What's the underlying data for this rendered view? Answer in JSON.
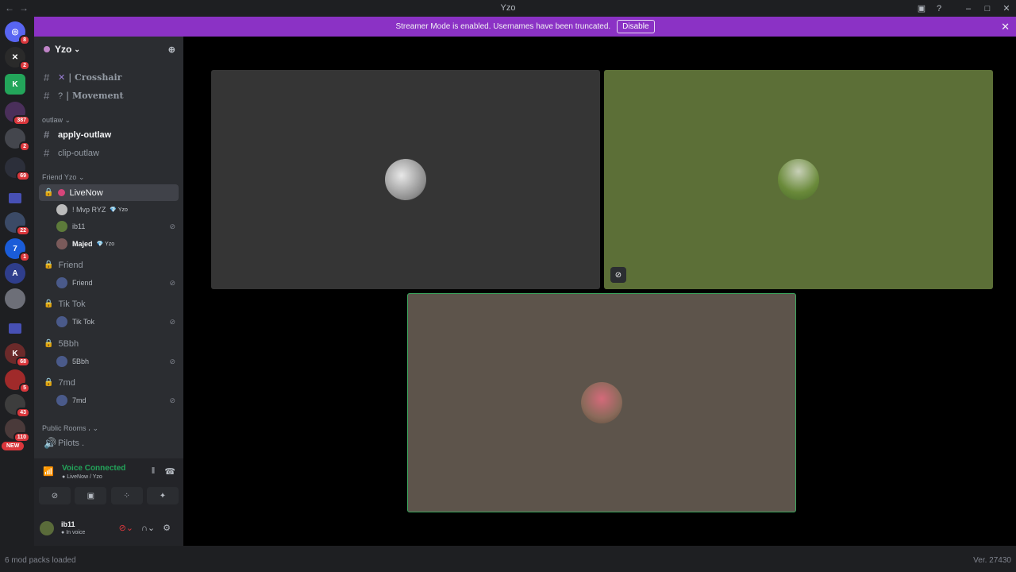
{
  "window": {
    "title": "Yzo",
    "back": "←",
    "forward": "→",
    "minimize": "–",
    "maximize": "□",
    "close": "✕"
  },
  "banner": {
    "text": "Streamer Mode is enabled. Usernames have been truncated.",
    "button": "Disable",
    "close": "✕"
  },
  "guilds": {
    "badges": [
      "8",
      "2",
      "387",
      "2",
      "69",
      "22",
      "1",
      "68",
      "5",
      "43",
      "110"
    ],
    "new_tag": "NEW"
  },
  "server": {
    "name": "Yzo"
  },
  "channels": [
    {
      "label": "| Crosshair"
    },
    {
      "label": "| Movement"
    }
  ],
  "categories": {
    "outlaw": "outlaw",
    "friend_yzo": "Friend Yzo",
    "public_rooms": "Public Rooms ،"
  },
  "outlaw_channels": [
    "apply-outlaw",
    "clip-outlaw"
  ],
  "voice_channels": [
    {
      "name": "LiveNow"
    },
    {
      "name": "Friend"
    },
    {
      "name": "Tik Tok"
    },
    {
      "name": "5Bbh"
    },
    {
      "name": "7md"
    }
  ],
  "livenow_users": [
    {
      "name": "! Mvp RYZ",
      "tag": "Yzo"
    },
    {
      "name": "ib11",
      "tag": ""
    },
    {
      "name": "Majed",
      "tag": "Yzo"
    }
  ],
  "room_users": [
    "Friend",
    "Tik Tok",
    "5Bbh",
    "7md"
  ],
  "pilots": "Pilots .",
  "voice": {
    "status": "Voice Connected",
    "location": "LiveNow / Yzo"
  },
  "user": {
    "name": "ib11",
    "status": "In voice"
  },
  "statusbar": {
    "left": "6 mod packs loaded",
    "right": "Ver. 27430"
  },
  "colors": {
    "accent": "#8b32c5",
    "voice_green": "#23a55a",
    "tile1": "#353535",
    "tile2": "#5c6f37",
    "tile3": "#5d544b"
  }
}
